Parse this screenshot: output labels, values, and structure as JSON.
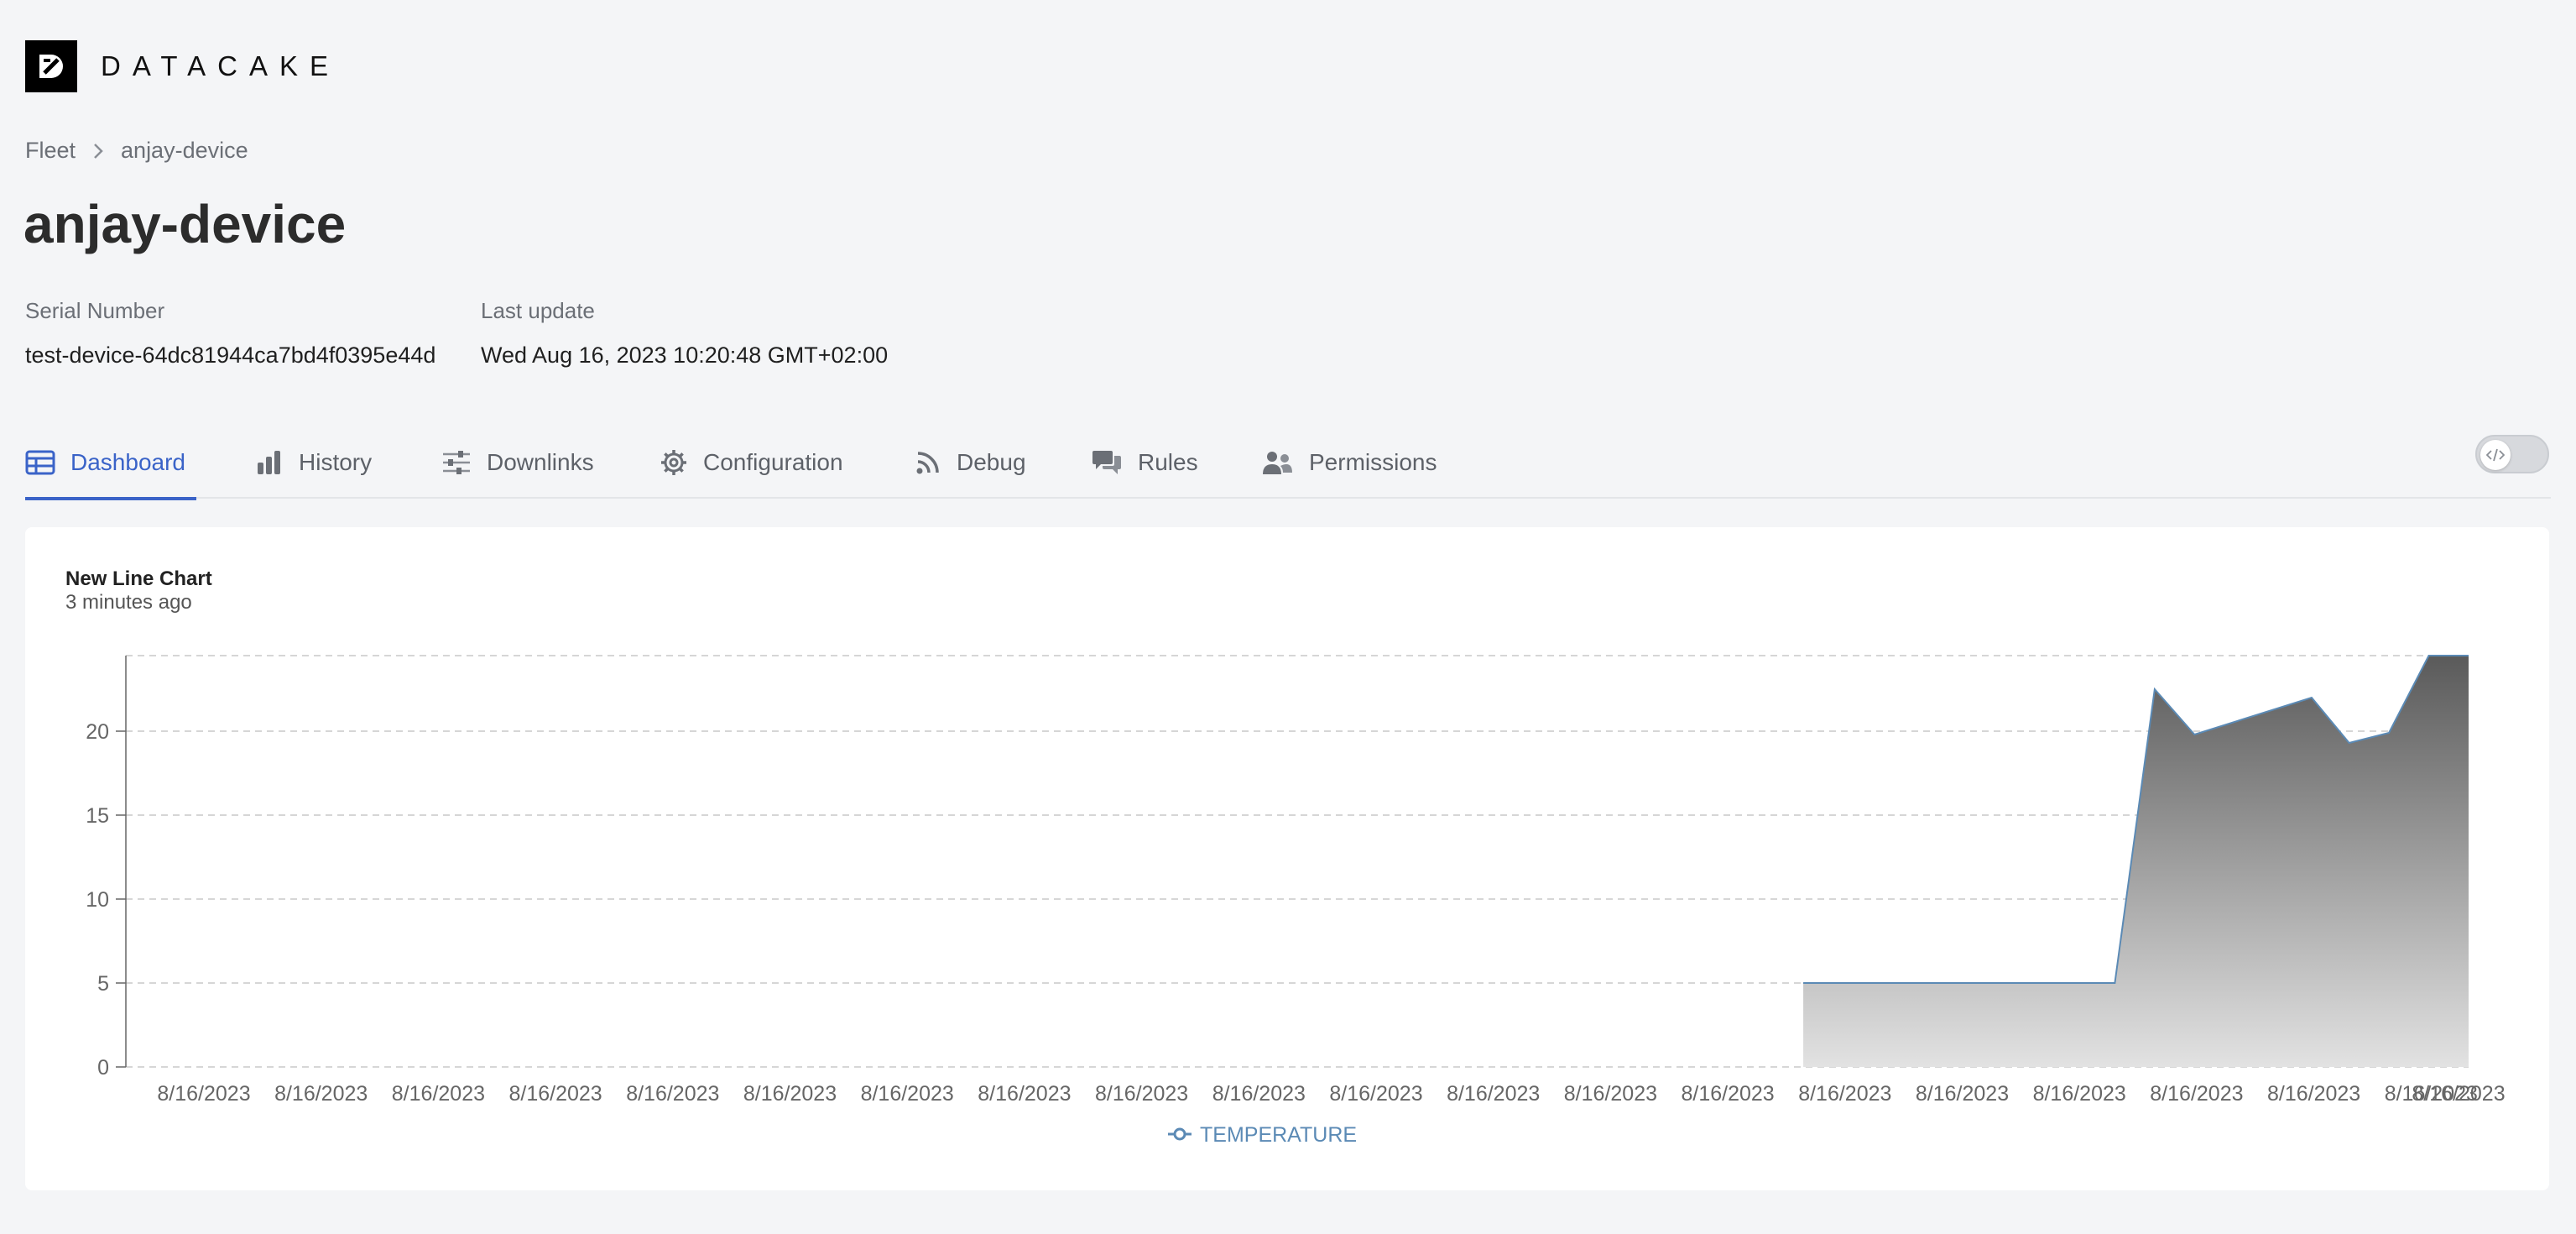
{
  "brand": {
    "name": "DATACAKE"
  },
  "breadcrumb": {
    "root": "Fleet",
    "current": "anjay-device"
  },
  "page": {
    "title": "anjay-device"
  },
  "meta": {
    "serial_label": "Serial Number",
    "serial_value": "test-device-64dc81944ca7bd4f0395e44d",
    "update_label": "Last update",
    "update_value": "Wed Aug 16, 2023 10:20:48 GMT+02:00"
  },
  "tabs": [
    {
      "label": "Dashboard",
      "icon": "table-icon",
      "active": true
    },
    {
      "label": "History",
      "icon": "bar-chart-icon"
    },
    {
      "label": "Downlinks",
      "icon": "sliders-icon"
    },
    {
      "label": "Configuration",
      "icon": "gear-icon"
    },
    {
      "label": "Debug",
      "icon": "rss-icon"
    },
    {
      "label": "Rules",
      "icon": "comments-icon"
    },
    {
      "label": "Permissions",
      "icon": "users-icon"
    }
  ],
  "colors": {
    "accent": "#3a63c8",
    "series_line": "#5b8ab5"
  },
  "widget": {
    "title": "New Line Chart",
    "subtitle": "3 minutes ago",
    "chart_data": {
      "type": "area",
      "title": "New Line Chart",
      "xlabel": "",
      "ylabel": "",
      "ylim": [
        0,
        24.5
      ],
      "yticks": [
        0,
        5,
        10,
        15,
        20
      ],
      "grid": true,
      "legend_position": "bottom-center",
      "x_tick_labels": [
        "8/16/2023",
        "8/16/2023",
        "8/16/2023",
        "8/16/2023",
        "8/16/2023",
        "8/16/2023",
        "8/16/2023",
        "8/16/2023",
        "8/16/2023",
        "8/16/2023",
        "8/16/2023",
        "8/16/2023",
        "8/16/2023",
        "8/16/2023",
        "8/16/2023",
        "8/16/2023",
        "8/16/2023",
        "8/16/2023",
        "8/16/2023",
        "8/16/2023",
        "8/16/2023"
      ],
      "series": [
        {
          "name": "TEMPERATURE",
          "x": [
            0.716,
            0.849,
            0.866,
            0.883,
            0.933,
            0.949,
            0.966,
            0.983,
            1.0
          ],
          "y": [
            5,
            5,
            22.5,
            19.8,
            22,
            19.3,
            19.9,
            24.5,
            24.5
          ]
        }
      ]
    }
  }
}
